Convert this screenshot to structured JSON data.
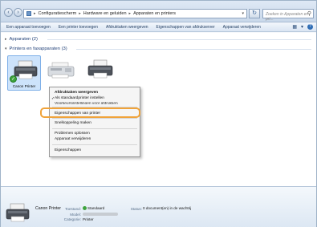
{
  "address_bar": {
    "crumbs": [
      "Configuratiescherm",
      "Hardware en geluiden",
      "Apparaten en printers"
    ],
    "search_placeholder": "Zoeken in Apparaten en pri..."
  },
  "toolbar": {
    "buttons": [
      "Een apparaat toevoegen",
      "Een printer toevoegen",
      "Afdruktaken weergeven",
      "Eigenschappen van afdrukserver",
      "Apparaat verwijderen"
    ]
  },
  "groups": {
    "devices_header": "Apparaten (2)",
    "printers_header": "Printers en faxapparaten (3)"
  },
  "printers": [
    {
      "label": "Canon Printer",
      "selected": true,
      "default": true
    },
    {
      "label": "",
      "selected": false,
      "default": false
    },
    {
      "label": "",
      "selected": false,
      "default": false
    }
  ],
  "context_menu": {
    "items": [
      {
        "label": "Afdruktaken weergeven",
        "bold": true
      },
      {
        "label": "Als standaardprinter instellen",
        "checked": true
      },
      {
        "label": "Voorkeursinstellingen voor afdrukken"
      },
      {
        "label": "Eigenschappen van printer",
        "highlighted": true
      },
      {
        "label": "Snelkoppeling maken"
      },
      {
        "label": "Problemen oplossen"
      },
      {
        "label": "Apparaat verwijderen"
      },
      {
        "label": "Eigenschappen"
      }
    ]
  },
  "details": {
    "name": "Canon Printer",
    "status_label": "Toestand:",
    "status_value": "Standaard",
    "model_label": "Model:",
    "category_label": "Categorie:",
    "category_value": "Printer",
    "status2_label": "Status:",
    "status2_value": "0 document(en) in de wachtrij"
  },
  "colors": {
    "highlight_ring": "#f0a33a",
    "selection": "#cde3fb",
    "default_check": "#3da33d"
  }
}
